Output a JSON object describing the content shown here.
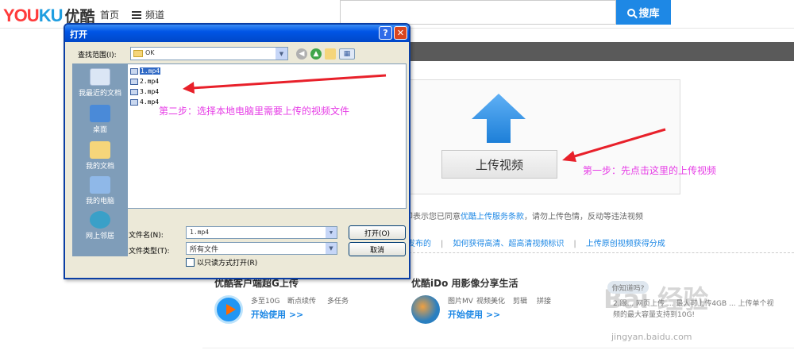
{
  "header": {
    "logo_you": "YOU",
    "logo_ku": "KU",
    "logo_cn": "优酷",
    "nav_home": "首页",
    "nav_channel": "频道",
    "search_placeholder": "",
    "search_button": "搜库",
    "brand_colors": {
      "you": "#ff3b3b",
      "ku": "#1f9ee0",
      "accent": "#1e88e5"
    }
  },
  "upload": {
    "button_label": "上传视频",
    "agree_text_prefix": "即表示您已同意",
    "agree_link": "优酷上传服务条款",
    "agree_text_suffix": "，请勿上传色情，反动等违法视频",
    "tips": [
      "发布的",
      "如何获得高清、超高清视频标识",
      "上传原创视频获得分成"
    ],
    "tip_sep": "|"
  },
  "sections": {
    "client": {
      "title": "优酷客户端超G上传",
      "features": [
        "多至10G",
        "断点续传",
        "多任务"
      ],
      "start": "开始使用 >>"
    },
    "ido": {
      "title": "优酷iDo 用影像分享生活",
      "features": [
        "图片MV",
        "视频美化",
        "剪辑",
        "拼接"
      ],
      "start": "开始使用 >>"
    },
    "faq": {
      "badge": "你知道吗?",
      "text": "2.跟... 网页上传 ... 最大可上传4GB ... 上传单个视频的最大容量支持到10G!"
    }
  },
  "watermark": {
    "mark": "Bai 经验",
    "url": "jingyan.baidu.com"
  },
  "annotations": {
    "step1": "第一步：先点击这里的上传视频",
    "step2": "第二步：选择本地电脑里需要上传的视频文件",
    "color": "#e63ce6"
  },
  "dialog": {
    "title": "打开",
    "help_btn": "?",
    "close_btn": "✕",
    "look_in_label": "查找范围(I):",
    "look_in_value": "OK",
    "places": [
      "我最近的文档",
      "桌面",
      "我的文档",
      "我的电脑",
      "网上邻居"
    ],
    "files": [
      "1.mp4",
      "2.mp4",
      "3.mp4",
      "4.mp4"
    ],
    "selected_file": "1.mp4",
    "filename_label": "文件名(N):",
    "filename_value": "1.mp4",
    "filetype_label": "文件类型(T):",
    "filetype_value": "所有文件",
    "readonly_label": "以只读方式打开(R)",
    "open_button": "打开(O)",
    "cancel_button": "取消"
  }
}
